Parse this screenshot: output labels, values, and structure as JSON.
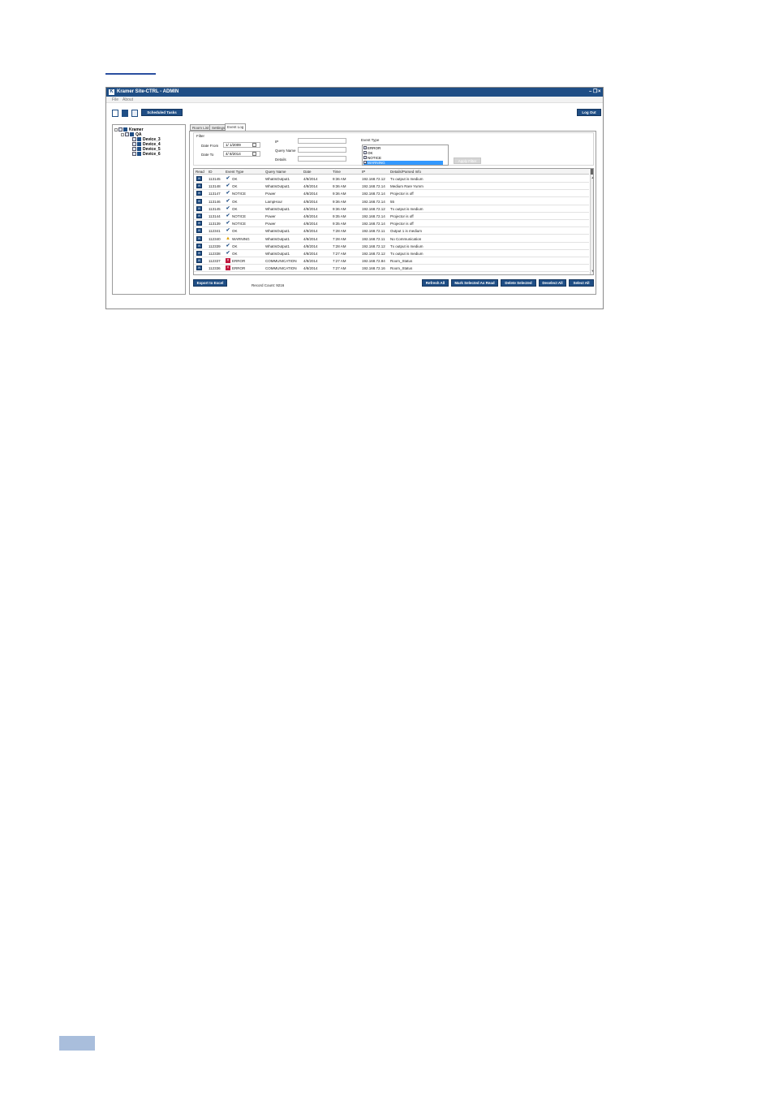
{
  "window": {
    "title": "Kramer Site-CTRL - ADMIN",
    "logo_letter": "K",
    "controls": {
      "minimize": "–",
      "restore": "❐",
      "close": "×"
    },
    "menu": [
      "File",
      "About"
    ]
  },
  "toolbar": {
    "icons": [
      "new-document-icon",
      "mail-icon",
      "grid-icon"
    ],
    "scheduled_tasks_label": "Scheduled Tasks",
    "logout_label": "Log Out"
  },
  "tree": {
    "root": "Kramer",
    "group": "QA",
    "devices": [
      "Device_3",
      "Device_4",
      "Device_5",
      "Device_6"
    ]
  },
  "tabs": [
    "Room List",
    "Settings",
    "Event Log"
  ],
  "active_tab": "Event Log",
  "filter": {
    "legend": "Filter",
    "date_from_label": "Date From",
    "date_from_value": "1/  1/2009",
    "date_to_label": "Date To",
    "date_to_value": "4/  8/2014",
    "ip_label": "IP",
    "ip_value": "",
    "query_name_label": "Query Name",
    "query_name_value": "",
    "details_label": "Details",
    "details_value": "",
    "event_type_label": "Event Type",
    "event_types": [
      "ERROR",
      "OK",
      "NOTICE",
      "WARNING"
    ],
    "selected_event_type": "WARNING",
    "apply_label": "Apply Filter"
  },
  "table": {
    "columns": [
      "Read",
      "ID",
      "Event Type",
      "Query Name",
      "Date",
      "Time",
      "IP",
      "Details/Parsed Info"
    ],
    "read_icon": "envelope-icon",
    "rows": [
      {
        "id": "113145",
        "type": "OK",
        "query": "WhatIsOutput1",
        "date": "4/8/2014",
        "time": "9:36 AM",
        "ip": "192.168.72.12",
        "details": "Tx output is medium"
      },
      {
        "id": "113148",
        "type": "OK",
        "query": "WhatIsOutput1",
        "date": "4/8/2014",
        "time": "9:36 AM",
        "ip": "192.168.72.14",
        "details": "Medium Rare Yumm"
      },
      {
        "id": "113147",
        "type": "NOTICE",
        "query": "Power",
        "date": "4/8/2014",
        "time": "9:36 AM",
        "ip": "192.168.72.14",
        "details": "Projector is off"
      },
      {
        "id": "113146",
        "type": "OK",
        "query": "LampHour",
        "date": "4/8/2014",
        "time": "9:36 AM",
        "ip": "192.168.72.14",
        "details": "55"
      },
      {
        "id": "113145",
        "type": "OK",
        "query": "WhatIsOutput1",
        "date": "4/8/2014",
        "time": "9:36 AM",
        "ip": "192.168.72.12",
        "details": "Tx output is medium"
      },
      {
        "id": "113144",
        "type": "NOTICE",
        "query": "Power",
        "date": "4/8/2014",
        "time": "9:35 AM",
        "ip": "192.168.72.14",
        "details": "Projector is off"
      },
      {
        "id": "113139",
        "type": "NOTICE",
        "query": "Power",
        "date": "4/8/2014",
        "time": "9:35 AM",
        "ip": "192.168.72.14",
        "details": "Projector is off"
      },
      {
        "id": "112341",
        "type": "OK",
        "query": "WhatIsOutput1",
        "date": "4/8/2014",
        "time": "7:28 AM",
        "ip": "192.168.72.11",
        "details": "Output 1 is medium"
      },
      {
        "id": "112340",
        "type": "WARNING",
        "query": "WhatIsOutput1",
        "date": "4/8/2014",
        "time": "7:28 AM",
        "ip": "192.168.72.11",
        "details": "No Communication"
      },
      {
        "id": "112339",
        "type": "OK",
        "query": "WhatIsOutput1",
        "date": "4/8/2014",
        "time": "7:28 AM",
        "ip": "192.168.72.12",
        "details": "Tx output is medium"
      },
      {
        "id": "112338",
        "type": "OK",
        "query": "WhatIsOutput1",
        "date": "4/8/2014",
        "time": "7:27 AM",
        "ip": "192.168.72.12",
        "details": "Tx output is medium"
      },
      {
        "id": "112337",
        "type": "ERROR",
        "query": "COMMUNICATION",
        "date": "4/8/2014",
        "time": "7:27 AM",
        "ip": "192.168.72.84",
        "details": "Room_Status"
      },
      {
        "id": "112336",
        "type": "ERROR",
        "query": "COMMUNICATION",
        "date": "4/8/2014",
        "time": "7:27 AM",
        "ip": "192.168.72.16",
        "details": "Room_Status"
      }
    ]
  },
  "footer": {
    "export_label": "Export to Excel",
    "record_count": "Record Count: 9216",
    "refresh_label": "Refresh All",
    "mark_read_label": "Mark Selected As Read",
    "delete_label": "Delete Selected",
    "deselect_label": "Deselect All",
    "select_label": "Select All"
  },
  "colors": {
    "accent": "#1f4e85",
    "error": "#c0143c",
    "warning": "#e0a000",
    "selection": "#3399ff"
  }
}
